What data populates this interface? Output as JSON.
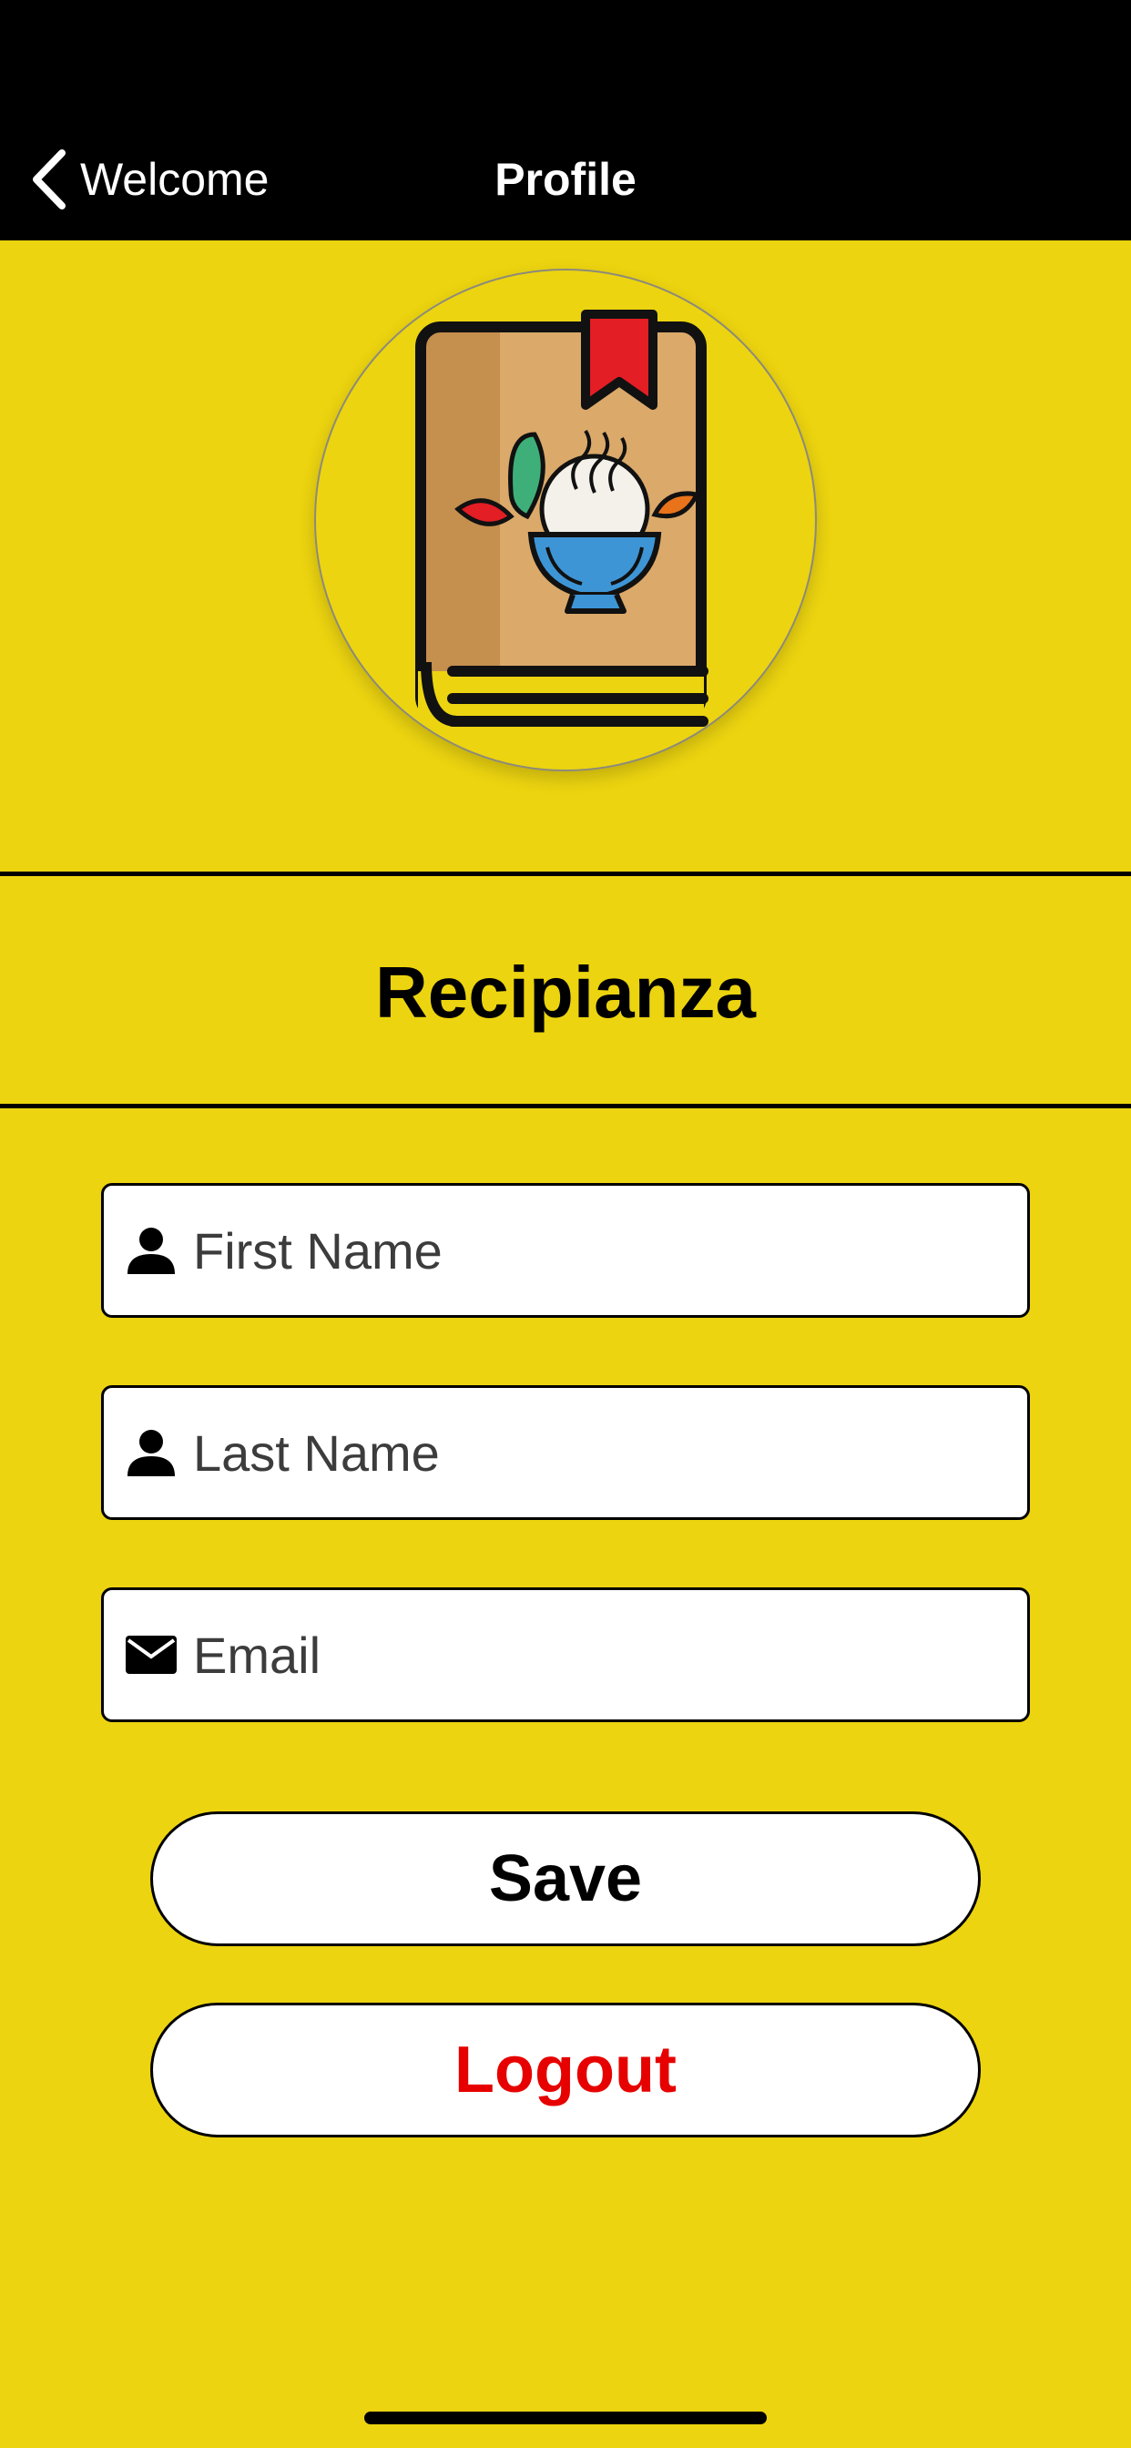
{
  "nav": {
    "back_label": "Welcome",
    "title": "Profile"
  },
  "brand": {
    "logo_icon": "recipe-book-bowl-icon",
    "app_name": "Recipianza"
  },
  "form": {
    "first_name": {
      "placeholder": "First Name",
      "value": "",
      "icon": "person-icon"
    },
    "last_name": {
      "placeholder": "Last Name",
      "value": "",
      "icon": "person-icon"
    },
    "email": {
      "placeholder": "Email",
      "value": "",
      "icon": "mail-icon"
    }
  },
  "buttons": {
    "save_label": "Save",
    "logout_label": "Logout"
  },
  "colors": {
    "background": "#ECD410",
    "nav_bar": "#000000",
    "logout_text": "#E60000",
    "save_text": "#000000"
  }
}
